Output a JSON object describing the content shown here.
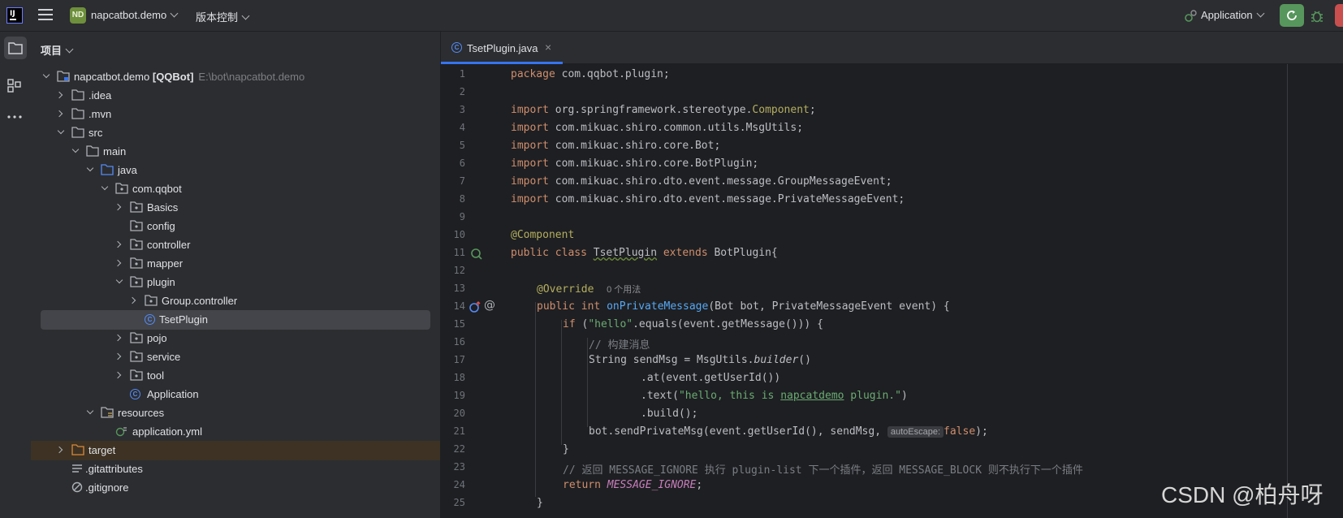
{
  "titlebar": {
    "logo_text": "IJ",
    "project_badge": "ND",
    "project_name": "napcatbot.demo",
    "vcs_label": "版本控制",
    "run_config": "Application"
  },
  "sidebar_panel": {
    "title": "项目",
    "tree": [
      {
        "label": "napcatbot.demo",
        "bold_suffix": "[QQBot]",
        "path": "E:\\bot\\napcatbot.demo"
      },
      {
        "label": ".idea"
      },
      {
        "label": ".mvn"
      },
      {
        "label": "src"
      },
      {
        "label": "main"
      },
      {
        "label": "java"
      },
      {
        "label": "com.qqbot"
      },
      {
        "label": "Basics"
      },
      {
        "label": "config"
      },
      {
        "label": "controller"
      },
      {
        "label": "mapper"
      },
      {
        "label": "plugin"
      },
      {
        "label": "Group.controller"
      },
      {
        "label": "TsetPlugin"
      },
      {
        "label": "pojo"
      },
      {
        "label": "service"
      },
      {
        "label": "tool"
      },
      {
        "label": "Application"
      },
      {
        "label": "resources"
      },
      {
        "label": "application.yml"
      },
      {
        "label": "target"
      },
      {
        "label": ".gitattributes"
      },
      {
        "label": ".gitignore"
      }
    ]
  },
  "editor": {
    "tab_label": "TsetPlugin.java",
    "tab_icon": "C",
    "line_numbers": [
      "1",
      "2",
      "3",
      "4",
      "5",
      "6",
      "7",
      "8",
      "9",
      "10",
      "11",
      "12",
      "13",
      "14",
      "15",
      "16",
      "17",
      "18",
      "19",
      "20",
      "21",
      "22",
      "23",
      "24",
      "25"
    ],
    "code": {
      "l1_kw": "package",
      "l1_rest": " com.qqbot.plugin;",
      "l3_kw": "import",
      "l3_a": " org.springframework.stereotype.",
      "l3_b": "Component",
      "l3_c": ";",
      "l4_kw": "import",
      "l4_rest": " com.mikuac.shiro.common.utils.MsgUtils;",
      "l5_kw": "import",
      "l5_rest": " com.mikuac.shiro.core.Bot;",
      "l6_kw": "import",
      "l6_rest": " com.mikuac.shiro.core.BotPlugin;",
      "l7_kw": "import",
      "l7_rest": " com.mikuac.shiro.dto.event.message.GroupMessageEvent;",
      "l8_kw": "import",
      "l8_rest": " com.mikuac.shiro.dto.event.message.PrivateMessageEvent;",
      "l10_an": "@Component",
      "l11_kw1": "public class ",
      "l11_cls": "TsetPlugin",
      "l11_kw2": " extends ",
      "l11_rest": "BotPlugin{",
      "l13_an": "@Override",
      "l13_hint": "0 个用法",
      "l14_kw": "public int ",
      "l14_fn": "onPrivateMessage",
      "l14_rest": "(Bot bot, PrivateMessageEvent event) {",
      "l15_kw": "if",
      "l15_a": " (",
      "l15_str": "\"hello\"",
      "l15_b": ".equals(event.getMessage())) {",
      "l16_cm": "// 构建消息",
      "l17_a": "String sendMsg = MsgUtils.",
      "l17_it": "builder",
      "l17_b": "()",
      "l18": ".at(event.getUserId())",
      "l19_a": ".text(",
      "l19_str1": "\"hello, this is ",
      "l19_str2": "napcatdemo",
      "l19_str3": " plugin.\"",
      "l19_b": ")",
      "l20": ".build();",
      "l21_a": "bot.sendPrivateMsg(event.getUserId(), sendMsg, ",
      "l21_hint": "autoEscape:",
      "l21_kw": "false",
      "l21_b": ");",
      "l22": "}",
      "l23_cm": "// 返回 MESSAGE_IGNORE 执行 plugin-list 下一个插件，返回 MESSAGE_BLOCK 则不执行下一个插件",
      "l24_kw": "return ",
      "l24_cst": "MESSAGE_IGNORE",
      "l24_b": ";",
      "l25": "}"
    }
  },
  "watermark": "CSDN @柏舟呀",
  "colors": {
    "accent": "#3574f0",
    "keyword": "#cf8e6d",
    "annotation": "#b3ae60",
    "string": "#6aab73",
    "function": "#56a8f5"
  }
}
